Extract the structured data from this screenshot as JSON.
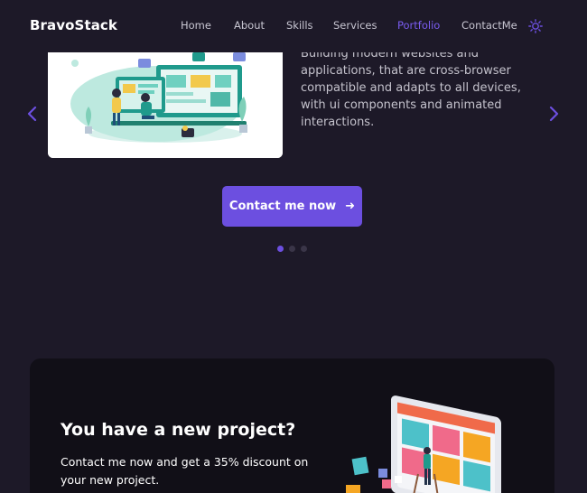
{
  "navbar": {
    "brand": "BravoStack",
    "links": [
      {
        "label": "Home",
        "active": false
      },
      {
        "label": "About",
        "active": false
      },
      {
        "label": "Skills",
        "active": false
      },
      {
        "label": "Services",
        "active": false
      },
      {
        "label": "Portfolio",
        "active": true
      },
      {
        "label": "ContactMe",
        "active": false
      }
    ],
    "theme_icon": "sun-icon"
  },
  "hero": {
    "slide_text": "Building modern websites and applications, that are cross-browser compatible and adapts to all devices, with ui components and animated interactions.",
    "cta_label": "Contact me now",
    "cta_icon": "arrow-right-icon",
    "prev_icon": "chevron-left-icon",
    "next_icon": "chevron-right-icon",
    "active_slide": 1,
    "slide_count": 3
  },
  "project": {
    "title": "You have a new project?",
    "description": "Contact me now and get a 35% discount on your new project."
  },
  "colors": {
    "background": "#1d1928",
    "accent": "#6c4fe0",
    "card": "#110f17",
    "text_muted": "#c4c2cc"
  }
}
